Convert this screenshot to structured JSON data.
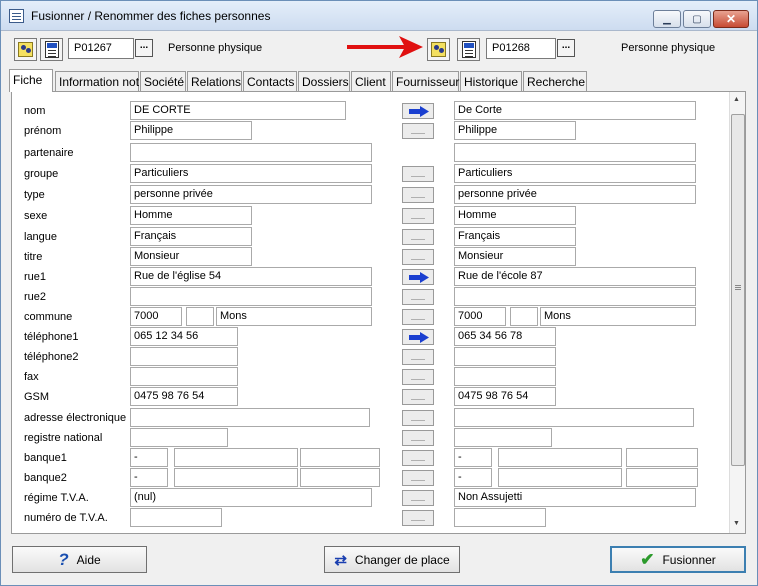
{
  "window": {
    "title": "Fusionner / Renommer des fiches personnes",
    "minimize": "▁",
    "maximize": "▢",
    "close": "✕"
  },
  "left": {
    "id": "P01267",
    "dots": "...",
    "type": "Personne physique"
  },
  "right": {
    "id": "P01268",
    "dots": "...",
    "type": "Personne physique"
  },
  "tabs": [
    "Fiche",
    "Information not.",
    "Société",
    "Relations",
    "Contacts",
    "Dossiers",
    "Client",
    "Fournisseur",
    "Historique",
    "Recherche"
  ],
  "labels": {
    "nom": "nom",
    "prenom": "prénom",
    "partenaire": "partenaire",
    "groupe": "groupe",
    "type": "type",
    "sexe": "sexe",
    "langue": "langue",
    "titre": "titre",
    "rue1": "rue1",
    "rue2": "rue2",
    "commune": "commune",
    "telephone1": "téléphone1",
    "telephone2": "téléphone2",
    "fax": "fax",
    "gsm": "GSM",
    "email": "adresse électronique",
    "registre": "registre national",
    "banque1": "banque1",
    "banque2": "banque2",
    "regime": "régime T.V.A.",
    "numtva": "numéro de T.V.A."
  },
  "leftValues": {
    "nom": "DE CORTE",
    "prenom": "Philippe",
    "partenaire": "",
    "groupe": "Particuliers",
    "type": "personne privée",
    "sexe": "Homme",
    "langue": "Français",
    "titre": "Monsieur",
    "rue1": "Rue de l'église 54",
    "rue2": "",
    "cp": "7000",
    "commune": "Mons",
    "telephone1": "065 12 34 56",
    "telephone2": "",
    "fax": "",
    "gsm": "0475 98 76 54",
    "email": "",
    "registre": "",
    "banque1a": "-",
    "banque2a": "-",
    "regime": "(nul)",
    "numtva": ""
  },
  "rightValues": {
    "nom": "De Corte",
    "prenom": "Philippe",
    "partenaire": "",
    "groupe": "Particuliers",
    "type": "personne privée",
    "sexe": "Homme",
    "langue": "Français",
    "titre": "Monsieur",
    "rue1": "Rue de l'école 87",
    "rue2": "",
    "cp": "7000",
    "commune": "Mons",
    "telephone1": "065 34 56 78",
    "telephone2": "",
    "fax": "",
    "gsm": "0475 98 76 54",
    "email": "",
    "registre": "",
    "banque1a": "-",
    "banque2a": "-",
    "regime": "Non Assujetti",
    "numtva": ""
  },
  "buttons": {
    "aide": "Aide",
    "changer": "Changer de place",
    "fusionner": "Fusionner"
  },
  "icons": {
    "help": "?",
    "swap": "⇄",
    "check": "✔"
  },
  "colors": {
    "accent_arrow": "#e01010",
    "blue_arrow": "#1a3fd0"
  }
}
